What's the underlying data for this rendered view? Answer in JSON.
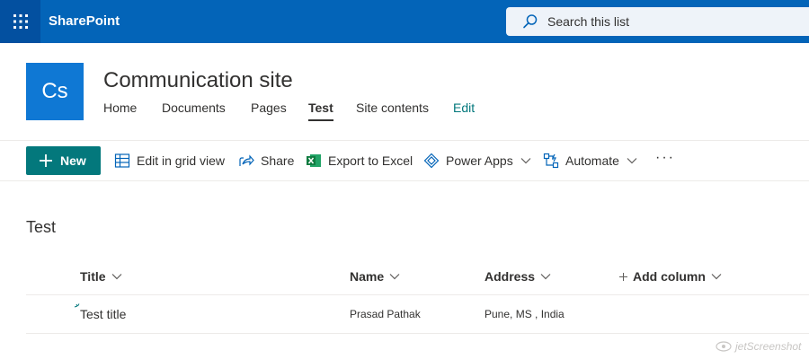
{
  "suitebar": {
    "brand": "SharePoint",
    "search_placeholder": "Search this list",
    "bg_color": "#0364b8"
  },
  "site": {
    "logo_initials": "Cs",
    "title": "Communication site",
    "logo_color": "#0f78d4",
    "nav": [
      {
        "label": "Home"
      },
      {
        "label": "Documents"
      },
      {
        "label": "Pages"
      },
      {
        "label": "Test",
        "active": true
      },
      {
        "label": "Site contents"
      },
      {
        "label": "Edit"
      }
    ]
  },
  "command_bar": {
    "new_label": "New",
    "accent_color": "#03787c",
    "commands": [
      {
        "label": "Edit in grid view",
        "icon": "grid-icon"
      },
      {
        "label": "Share",
        "icon": "share-icon"
      },
      {
        "label": "Export to Excel",
        "icon": "excel-icon"
      },
      {
        "label": "Power Apps",
        "icon": "power-apps-icon"
      },
      {
        "label": "Automate",
        "icon": "automate-icon"
      }
    ],
    "more_label": "···"
  },
  "list": {
    "title": "Test",
    "columns": [
      "Title",
      "Name",
      "Address",
      "Add column"
    ],
    "rows": [
      {
        "title": "Test title",
        "name": "Prasad Pathak",
        "address": "Pune, MS , India"
      }
    ]
  },
  "watermark": "jetScreenshot"
}
